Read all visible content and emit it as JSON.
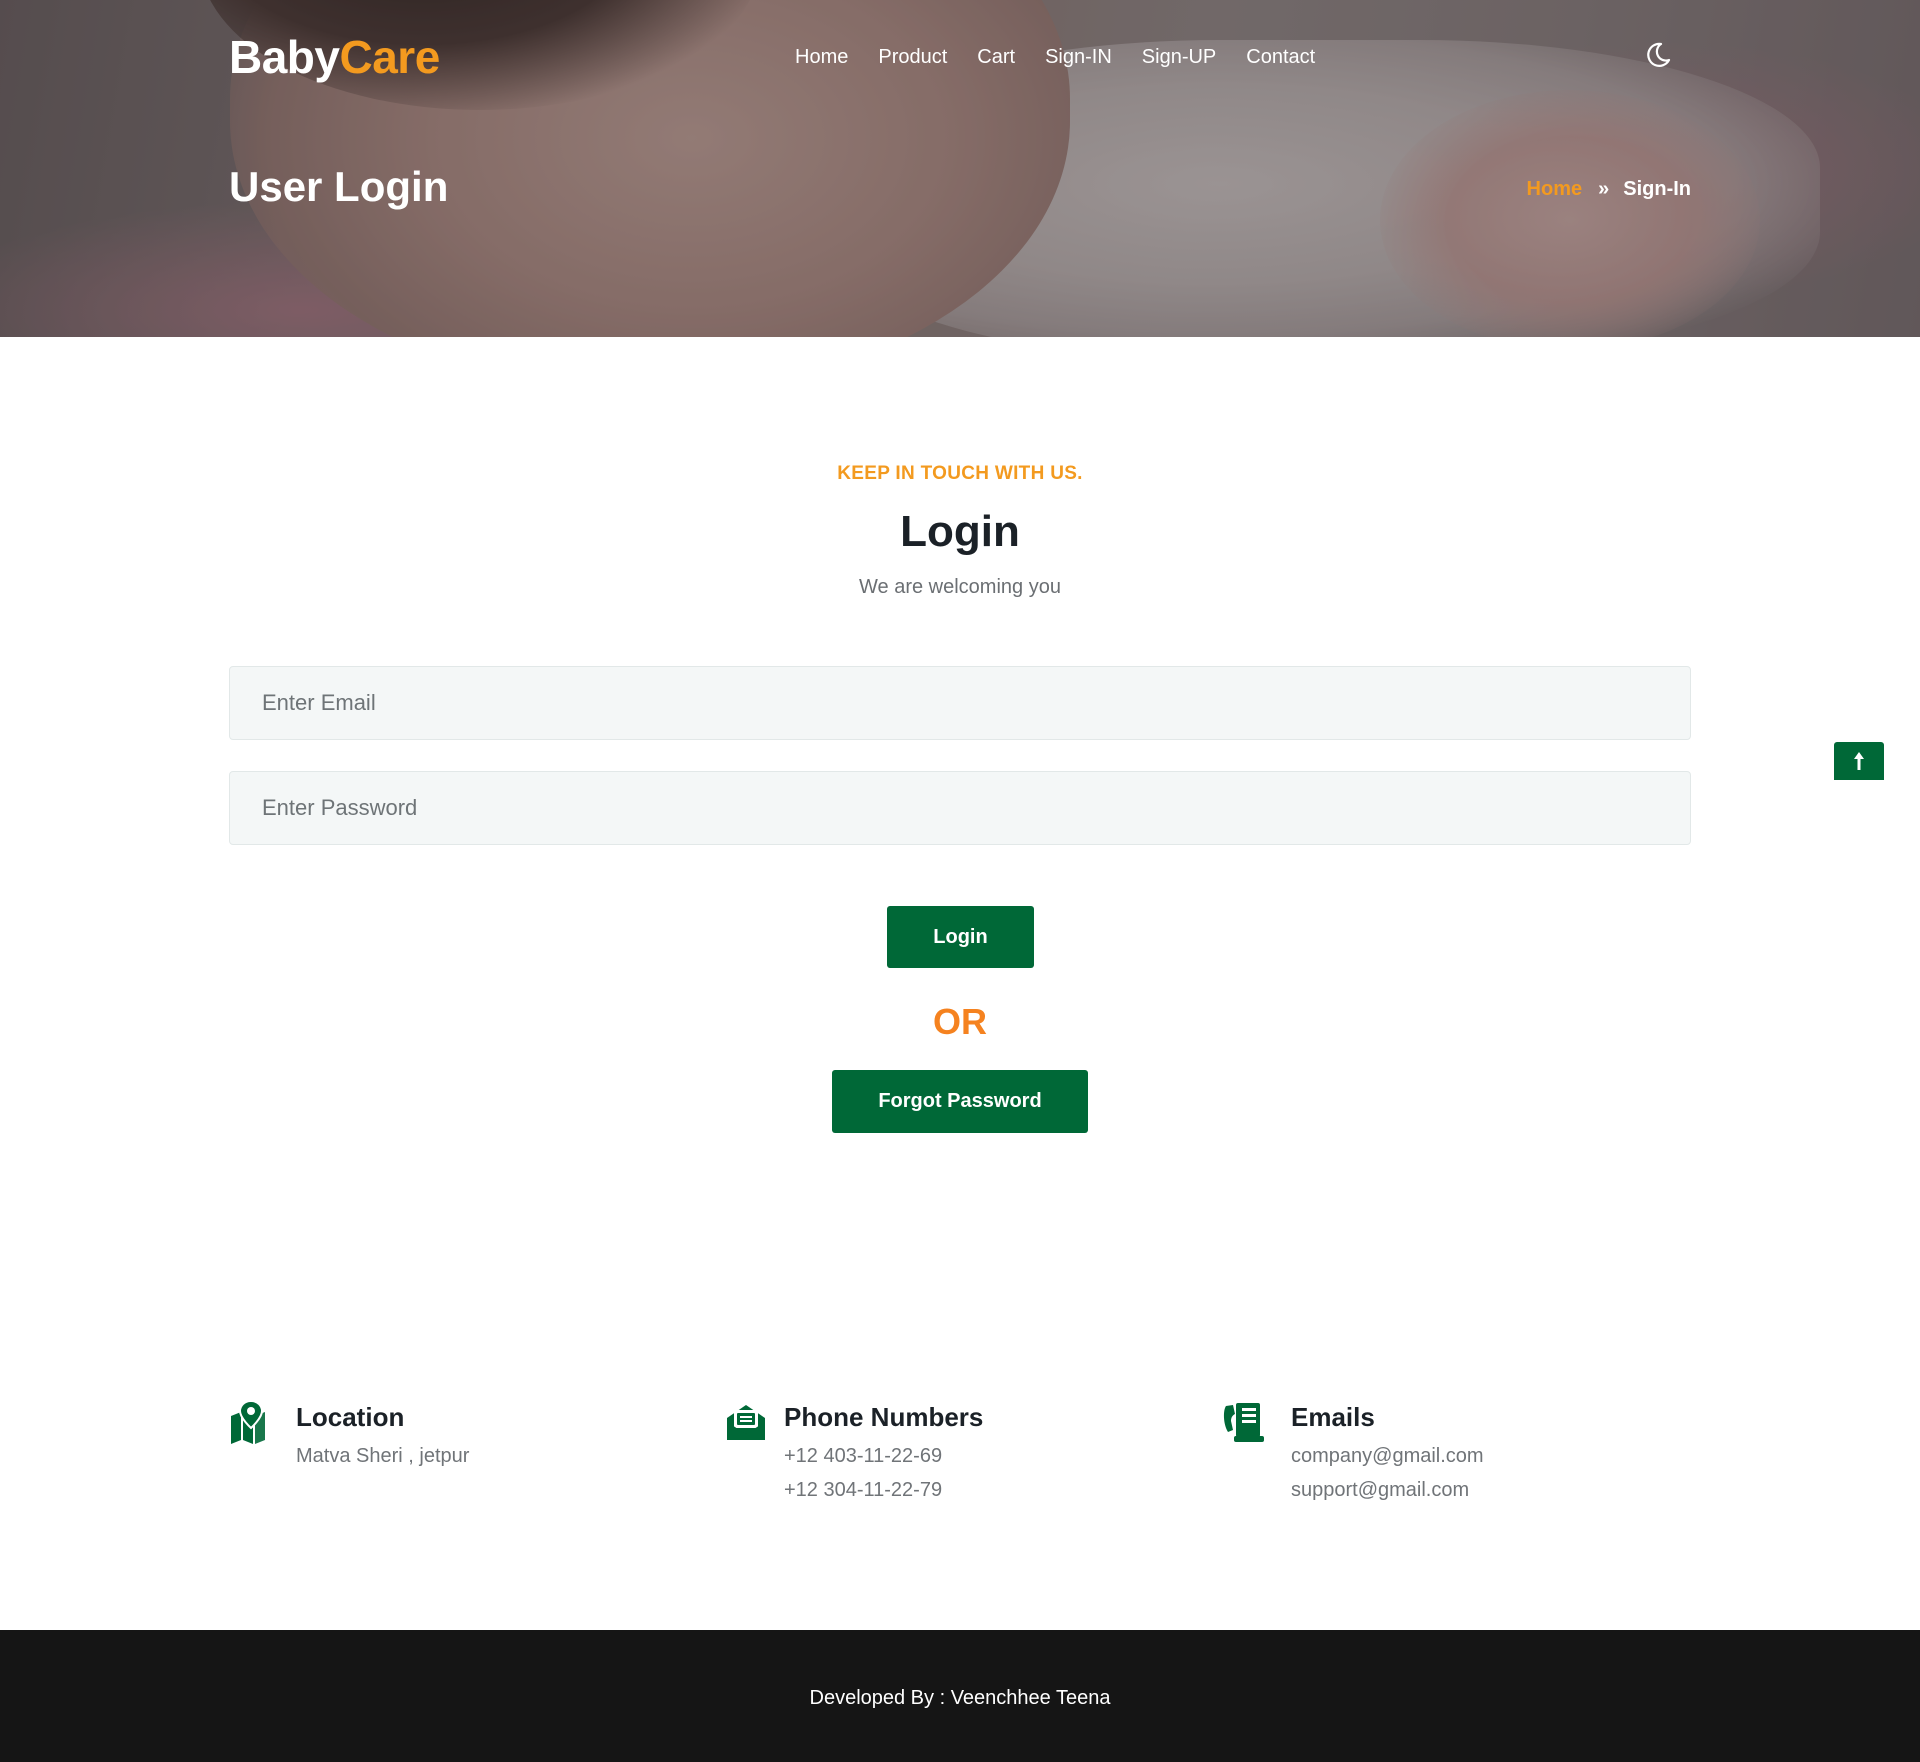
{
  "brand": {
    "part1": "Baby",
    "part2": "Care"
  },
  "nav": {
    "items": [
      {
        "label": "Home"
      },
      {
        "label": "Product"
      },
      {
        "label": "Cart"
      },
      {
        "label": "Sign-IN"
      },
      {
        "label": "Sign-UP"
      },
      {
        "label": "Contact"
      }
    ],
    "theme_icon": "moon-icon"
  },
  "hero": {
    "title": "User Login",
    "breadcrumb": {
      "home": "Home",
      "separator": "»",
      "current": "Sign-In"
    }
  },
  "login": {
    "eyebrow": "KEEP IN TOUCH WITH US.",
    "heading": "Login",
    "subheading": "We are welcoming you",
    "email": {
      "placeholder": "Enter Email",
      "value": ""
    },
    "password": {
      "placeholder": "Enter Password",
      "value": ""
    },
    "login_button": "Login",
    "or_text": "OR",
    "forgot_button": "Forgot Password"
  },
  "contacts": [
    {
      "icon": "map-location-icon",
      "title": "Location",
      "lines": [
        "Matva Sheri , jetpur"
      ]
    },
    {
      "icon": "envelope-open-icon",
      "title": "Phone Numbers",
      "lines": [
        "+12 403-11-22-69",
        "+12 304-11-22-79"
      ]
    },
    {
      "icon": "phone-fax-icon",
      "title": "Emails",
      "lines": [
        "company@gmail.com",
        "support@gmail.com"
      ]
    }
  ],
  "footer": {
    "credit": "Developed By : Veenchhee Teena"
  },
  "scroll_top_icon": "arrow-up-icon",
  "colors": {
    "accent": "#f39a1f",
    "primary": "#006837",
    "or": "#f5821f",
    "footer": "#151515"
  }
}
